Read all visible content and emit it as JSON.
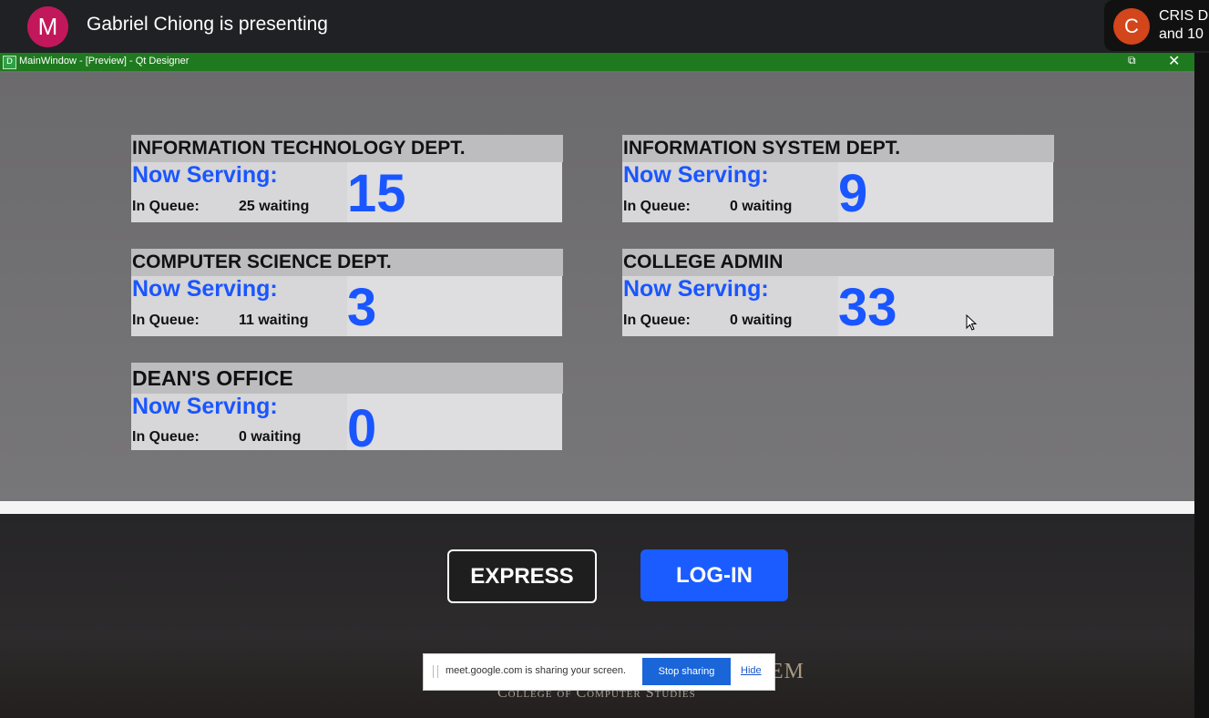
{
  "meet": {
    "presenter_initial": "M",
    "presenter_text": "Gabriel Chiong is presenting",
    "participant_initial": "C",
    "participant_name": "CRIS D\nand 10"
  },
  "qt": {
    "window_title": "MainWindow - [Preview] - Qt Designer",
    "app_icon": "D",
    "restore_icon": "restore-icon",
    "close_icon": "close-icon"
  },
  "labels": {
    "now_serving": "Now Serving:",
    "in_queue": "In Queue:"
  },
  "departments": [
    {
      "name": "INFORMATION TECHNOLOGY DEPT.",
      "now_serving": "15",
      "waiting": "25 waiting"
    },
    {
      "name": "INFORMATION SYSTEM DEPT.",
      "now_serving": "9",
      "waiting": "0 waiting"
    },
    {
      "name": "COMPUTER SCIENCE DEPT.",
      "now_serving": "3",
      "waiting": "11 waiting"
    },
    {
      "name": "COLLEGE ADMIN",
      "now_serving": "33",
      "waiting": "0 waiting"
    },
    {
      "name": "DEAN'S OFFICE",
      "now_serving": "0",
      "waiting": "0 waiting"
    }
  ],
  "buttons": {
    "express": "EXPRESS",
    "login": "LOG-IN"
  },
  "branding": {
    "partial_title": "EM",
    "college": "College of Computer Studies"
  },
  "share_bar": {
    "message": "meet.google.com is sharing your screen.",
    "stop_label": "Stop sharing",
    "hide_label": "Hide"
  },
  "colors": {
    "accent_blue": "#1a56ff",
    "qt_title_green": "#1f7a1f",
    "presenter_avatar": "#c2185b",
    "participant_avatar": "#d3451a"
  }
}
